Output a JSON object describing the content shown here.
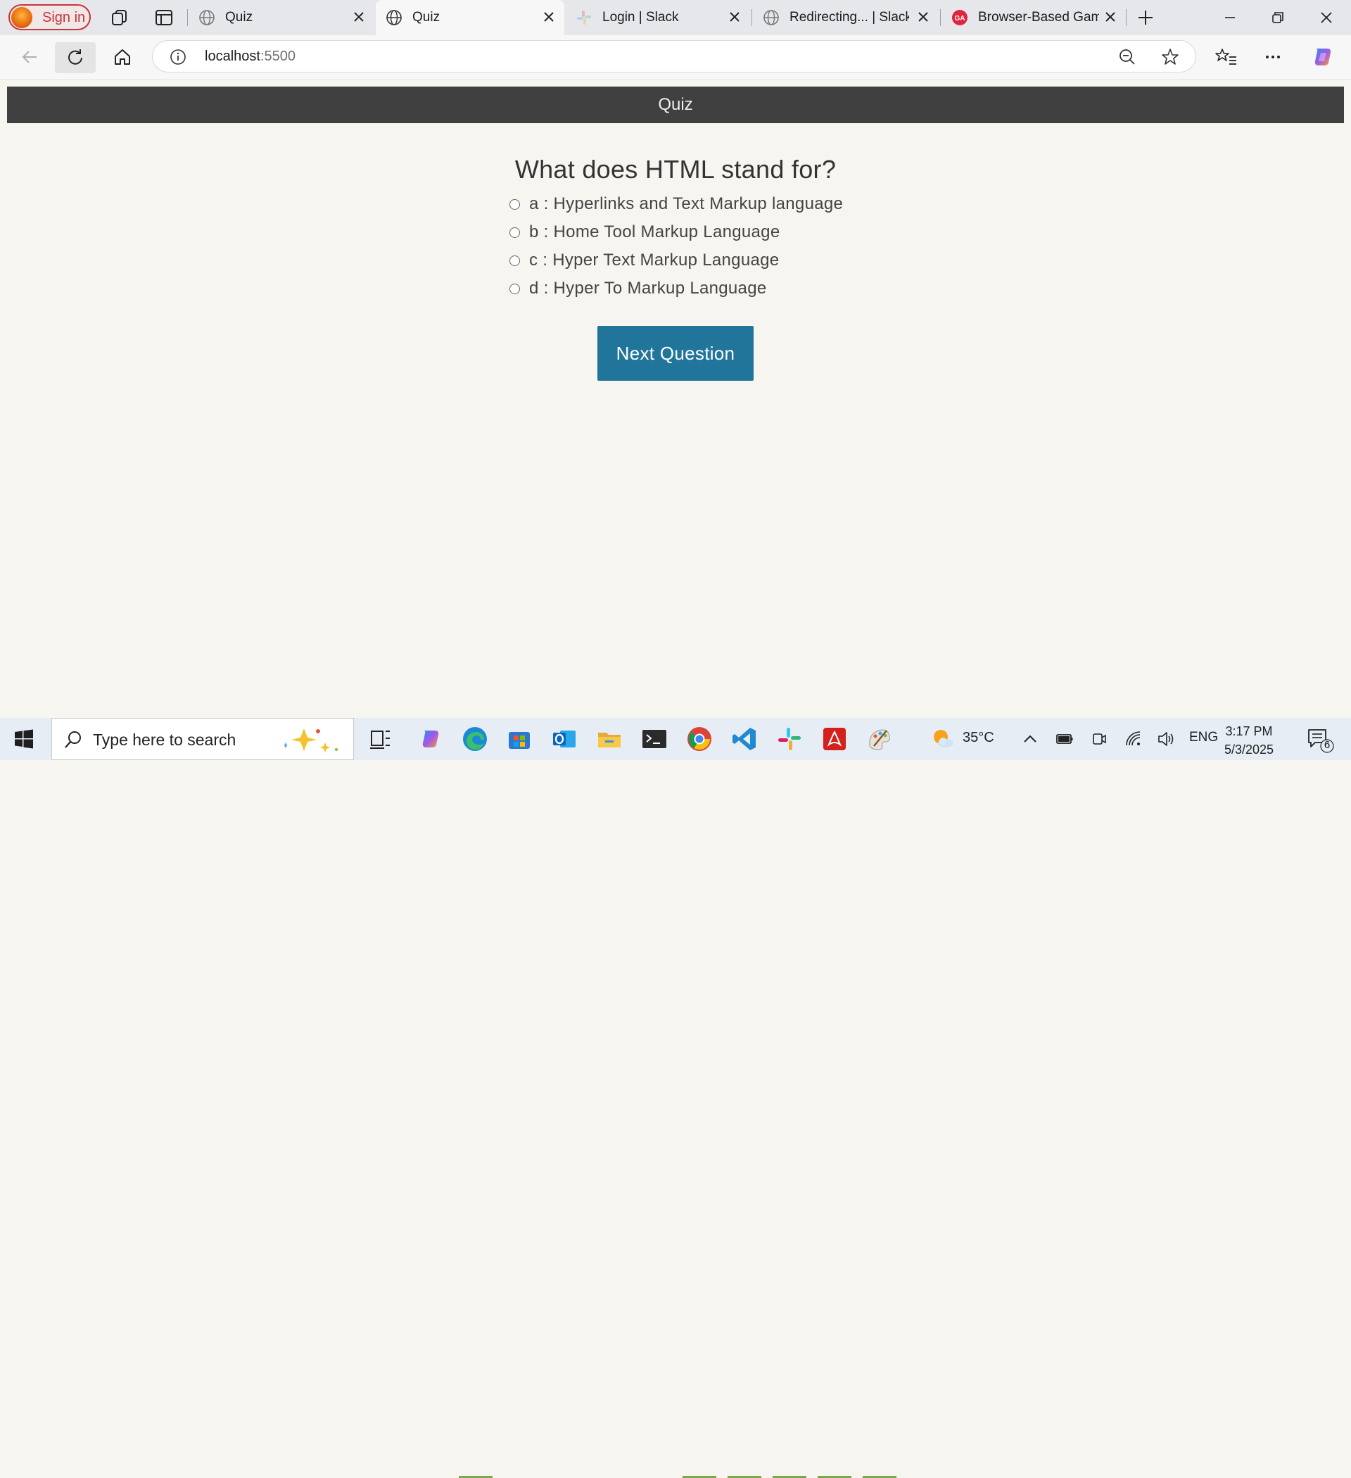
{
  "browser": {
    "profile_label": "Sign in",
    "tabs": [
      {
        "title": "Quiz",
        "icon": "globe-icon",
        "active": false
      },
      {
        "title": "Quiz",
        "icon": "globe-icon",
        "active": true
      },
      {
        "title": "Login | Slack",
        "icon": "slack-icon",
        "active": false
      },
      {
        "title": "Redirecting... | Slack",
        "icon": "globe-icon",
        "active": false
      },
      {
        "title": "Browser-Based Game",
        "icon": "ga-icon",
        "active": false
      }
    ],
    "address": {
      "host": "localhost",
      "port": ":5500"
    }
  },
  "page": {
    "header_title": "Quiz",
    "question": "What does HTML stand for?",
    "answers": [
      "a : Hyperlinks and Text Markup language",
      "b : Home Tool Markup Language",
      "c : Hyper Text Markup Language",
      "d : Hyper To Markup Language"
    ],
    "next_button": "Next Question"
  },
  "taskbar": {
    "search_placeholder": "Type here to search",
    "weather": "35°C",
    "language": "ENG",
    "time": "3:17 PM",
    "date": "5/3/2025",
    "notification_count": "6"
  },
  "colors": {
    "header_bg": "#404040",
    "button_bg": "#21759b",
    "page_bg": "#f7f5f0"
  }
}
